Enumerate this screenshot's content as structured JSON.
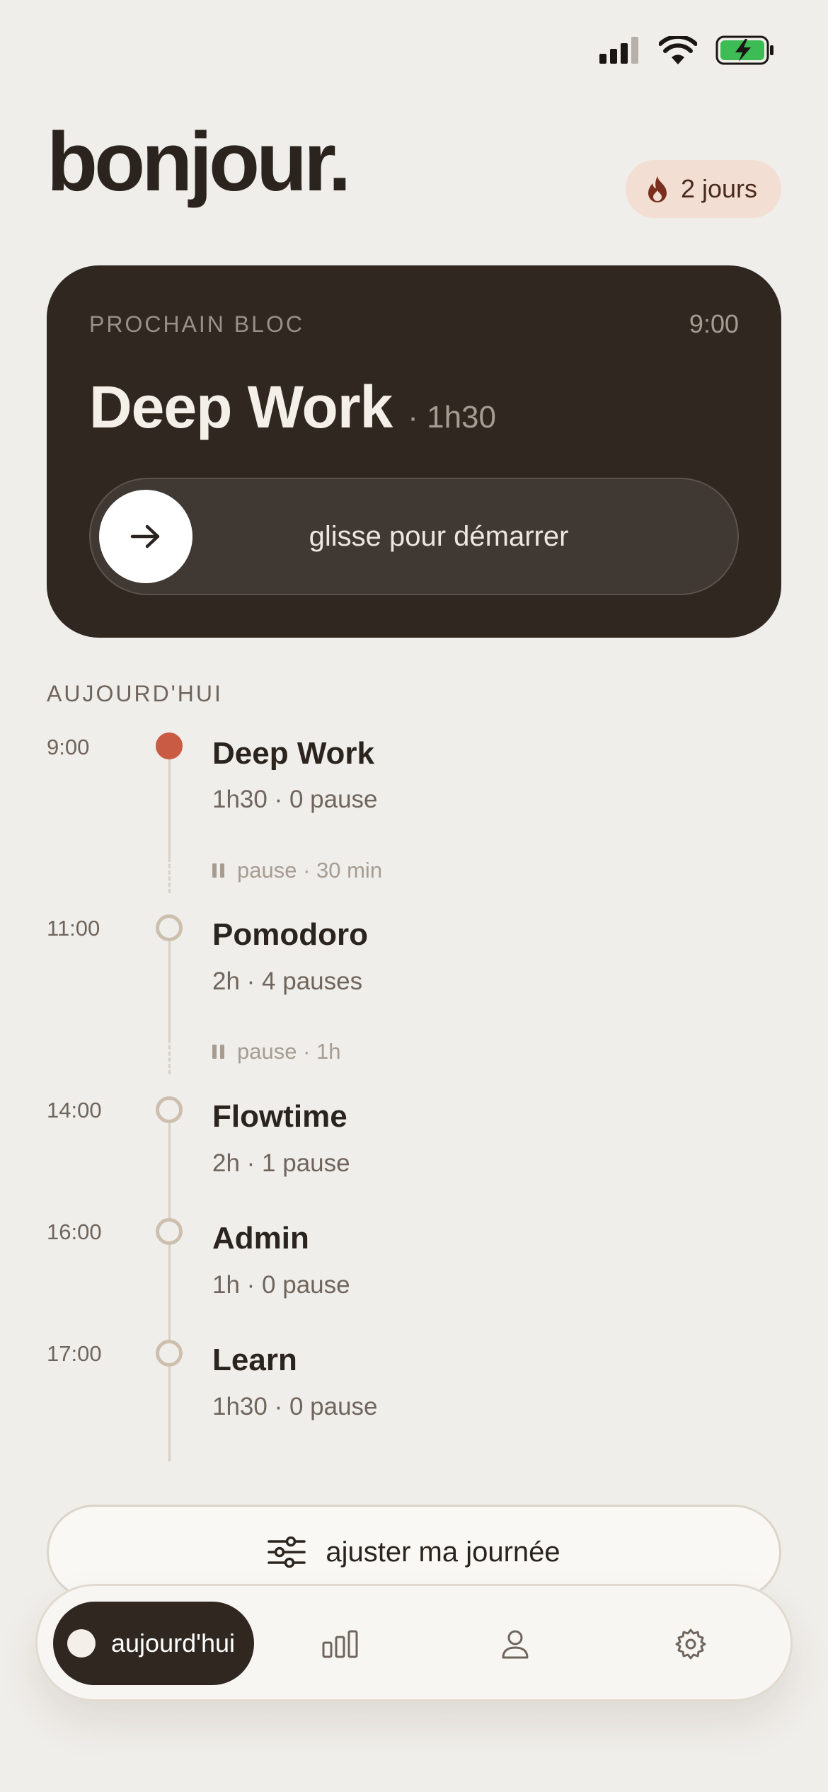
{
  "status_bar": {
    "icons": [
      "cellular-signal-icon",
      "wifi-icon",
      "battery-charging-icon"
    ],
    "battery_color": "#3DBB55"
  },
  "header": {
    "greeting": "bonjour.",
    "streak_label": "2 jours",
    "streak_icon": "flame-icon"
  },
  "next_block": {
    "label": "PROCHAIN BLOC",
    "time": "9:00",
    "title": "Deep Work",
    "duration": "· 1h30",
    "slide_hint": "glisse pour démarrer",
    "slide_icon": "arrow-right-icon"
  },
  "today": {
    "label": "AUJOURD'HUI",
    "blocks": [
      {
        "time": "9:00",
        "title": "Deep Work",
        "subtitle": "1h30 · 0 pause",
        "active": true
      },
      {
        "time": "11:00",
        "title": "Pomodoro",
        "subtitle": "2h · 4 pauses",
        "active": false
      },
      {
        "time": "14:00",
        "title": "Flowtime",
        "subtitle": "2h · 1 pause",
        "active": false
      },
      {
        "time": "16:00",
        "title": "Admin",
        "subtitle": "1h · 0 pause",
        "active": false
      },
      {
        "time": "17:00",
        "title": "Learn",
        "subtitle": "1h30 · 0 pause",
        "active": false
      }
    ],
    "breaks": [
      {
        "label": "pause · 30 min"
      },
      {
        "label": "pause · 1h"
      }
    ]
  },
  "adjust_button": {
    "label": "ajuster ma journée",
    "icon": "sliders-icon"
  },
  "nav": {
    "active_label": "aujourd'hui",
    "items": [
      "today-dot-icon",
      "stats-icon",
      "profile-icon",
      "settings-icon"
    ]
  },
  "colors": {
    "background": "#F0EEEA",
    "card": "#2F2720",
    "accent": "#C95A44",
    "streak_bg": "#F2DED2"
  }
}
